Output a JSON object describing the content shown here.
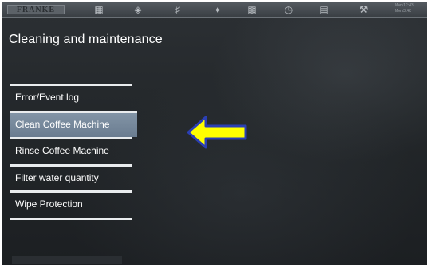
{
  "topbar": {
    "brand": "FRANKE",
    "icons": [
      "milk-icon",
      "pot-icon",
      "tools-icon",
      "drop-icon",
      "cup-icon",
      "clock-icon",
      "book-icon",
      "wrench-icon"
    ],
    "clock": [
      "Mon 12:43",
      "Mon 3:48"
    ]
  },
  "page": {
    "title": "Cleaning and maintenance"
  },
  "menu": {
    "items": [
      {
        "label": "Error/Event log"
      },
      {
        "label": "Clean Coffee Machine"
      },
      {
        "label": "Rinse Coffee Machine"
      },
      {
        "label": "Filter water quantity"
      },
      {
        "label": "Wipe Protection"
      }
    ],
    "selected": "Clean Coffee Machine"
  },
  "colors": {
    "background": "#23272a",
    "selected_item": "#6e8094",
    "arrow_fill": "#ffff00",
    "arrow_outline": "#2b3fb4"
  }
}
